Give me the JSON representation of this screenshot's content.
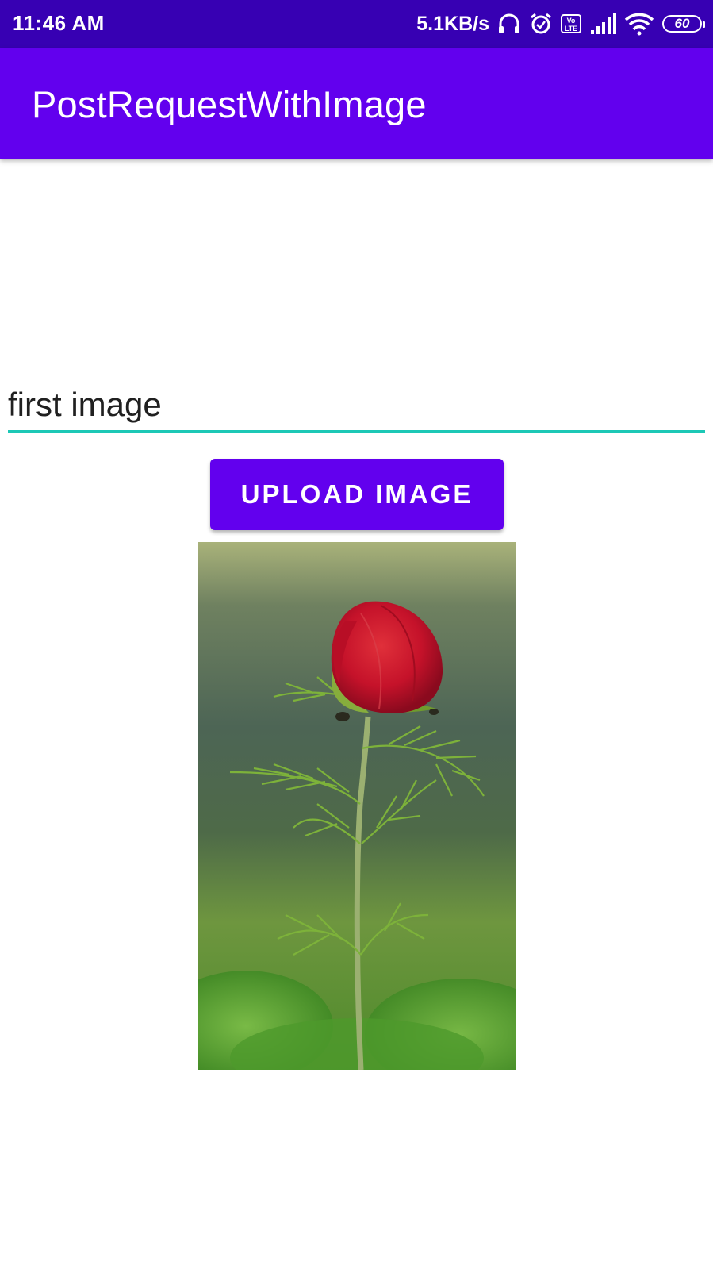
{
  "status_bar": {
    "time": "11:46 AM",
    "net_speed": "5.1KB/s",
    "volte_label": "Vo LTE",
    "battery_level": "60",
    "icons": [
      "headset-icon",
      "alarm-icon",
      "volte-icon",
      "signal-icon",
      "wifi-icon",
      "battery-icon"
    ]
  },
  "app_bar": {
    "title": "PostRequestWithImage"
  },
  "form": {
    "text_value": "first image",
    "upload_label": "UPLOAD IMAGE"
  },
  "image": {
    "subject": "red peony bud on green stem"
  },
  "colors": {
    "status_bar": "#3700b3",
    "primary": "#6200ee",
    "accent_underline": "#1cc8b6"
  }
}
